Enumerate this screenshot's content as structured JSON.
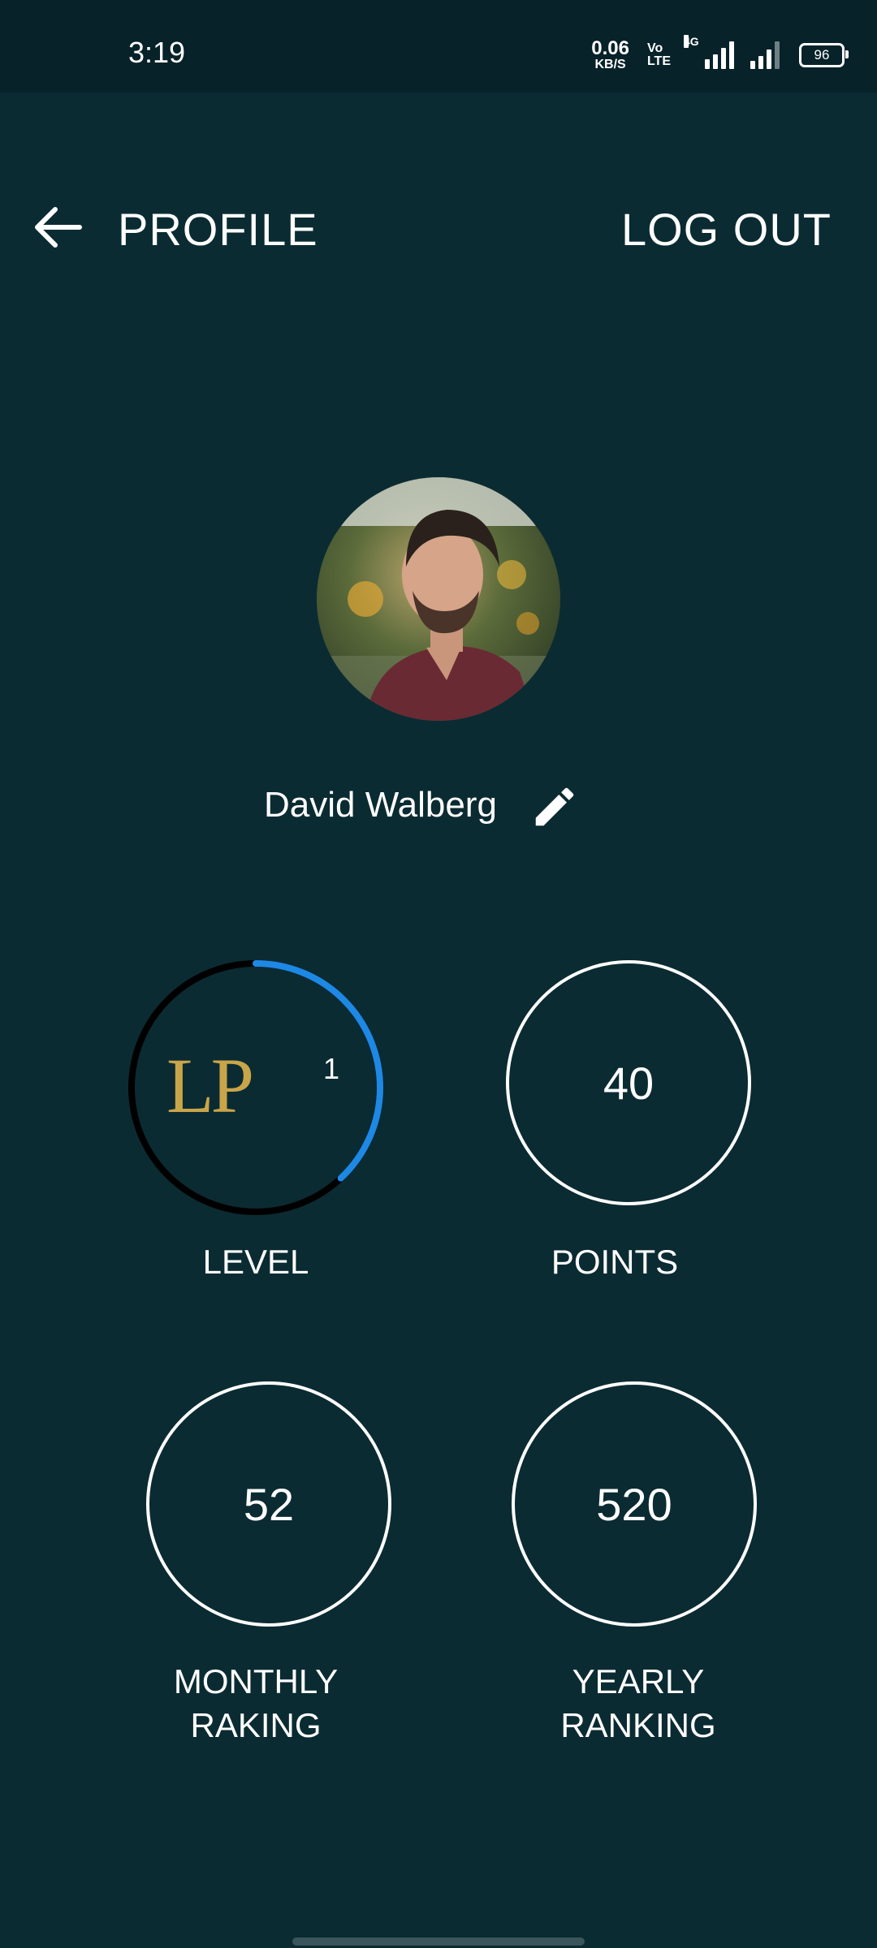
{
  "status_bar": {
    "time": "3:19",
    "net_speed_value": "0.06",
    "net_speed_unit": "KB/S",
    "volte_top": "Vo",
    "volte_bottom": "LTE",
    "network_type": "4G",
    "battery": "96"
  },
  "header": {
    "title": "PROFILE",
    "logout_label": "LOG OUT",
    "back_icon": "arrow-left-icon"
  },
  "profile": {
    "name": "David Walberg",
    "edit_icon": "pencil-icon"
  },
  "stats": {
    "level": {
      "logo_text": "LP",
      "value": "1",
      "label": "LEVEL",
      "progress": 0.38
    },
    "points": {
      "value": "40",
      "label": "POINTS"
    },
    "monthly": {
      "value": "52",
      "label_line1": "MONTHLY",
      "label_line2": "RAKING"
    },
    "yearly": {
      "value": "520",
      "label_line1": "YEARLY",
      "label_line2": "RANKING"
    }
  },
  "colors": {
    "background": "#0b2b32",
    "status_bar": "#08222a",
    "progress": "#1e88e5",
    "progress_track": "#000000",
    "ring": "#ffffff"
  }
}
